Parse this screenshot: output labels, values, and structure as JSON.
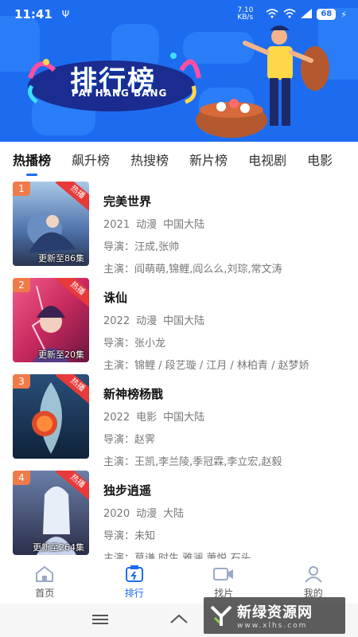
{
  "status": {
    "time": "11:41",
    "speed": "7.10 KB/s",
    "battery": "68"
  },
  "banner": {
    "title": "排行榜",
    "subtitle": "PAI HANG BANG"
  },
  "tabs": [
    {
      "label": "热播榜",
      "active": true
    },
    {
      "label": "飙升榜",
      "active": false
    },
    {
      "label": "热搜榜",
      "active": false
    },
    {
      "label": "新片榜",
      "active": false
    },
    {
      "label": "电视剧",
      "active": false
    },
    {
      "label": "电影",
      "active": false
    }
  ],
  "items": [
    {
      "rank": "1",
      "badge": "热播",
      "update": "更新至86集",
      "title": "完美世界",
      "year": "2021",
      "type": "动漫",
      "region": "中国大陆",
      "director": "导演：汪成,张帅",
      "cast": "主演：阎萌萌,锦鲤,阎么么,刘琮,常文涛"
    },
    {
      "rank": "2",
      "badge": "热播",
      "update": "更新至20集",
      "title": "诛仙",
      "year": "2022",
      "type": "动漫",
      "region": "中国大陆",
      "director": "导演：张小龙",
      "cast": "主演：锦鲤 / 段艺璇 / 江月 / 林柏青 / 赵梦娇"
    },
    {
      "rank": "3",
      "badge": "热播",
      "update": "",
      "title": "新神榜杨戬",
      "year": "2022",
      "type": "电影",
      "region": "中国大陆",
      "director": "导演：赵霁",
      "cast": "主演：王凯,李兰陵,季冠霖,李立宏,赵毅"
    },
    {
      "rank": "4",
      "badge": "热播",
      "update": "更新至264集",
      "title": "独步逍遥",
      "year": "2020",
      "type": "动漫",
      "region": "大陆",
      "director": "导演：未知",
      "cast": "主演：莫谦,时生,雅澜,萧悦,石头"
    }
  ],
  "bottom_nav": [
    {
      "label": "首页",
      "icon": "home-icon",
      "active": false
    },
    {
      "label": "排行",
      "icon": "ranking-icon",
      "active": true
    },
    {
      "label": "找片",
      "icon": "video-camera-icon",
      "active": false
    },
    {
      "label": "我的",
      "icon": "person-icon",
      "active": false
    }
  ],
  "watermark": {
    "title": "新绿资源网",
    "url": "www.xlhs.com"
  },
  "colors": {
    "accent": "#1d6cf0",
    "rank_badge": "#f07b4a",
    "hot_ribbon": "#e83a3a"
  }
}
